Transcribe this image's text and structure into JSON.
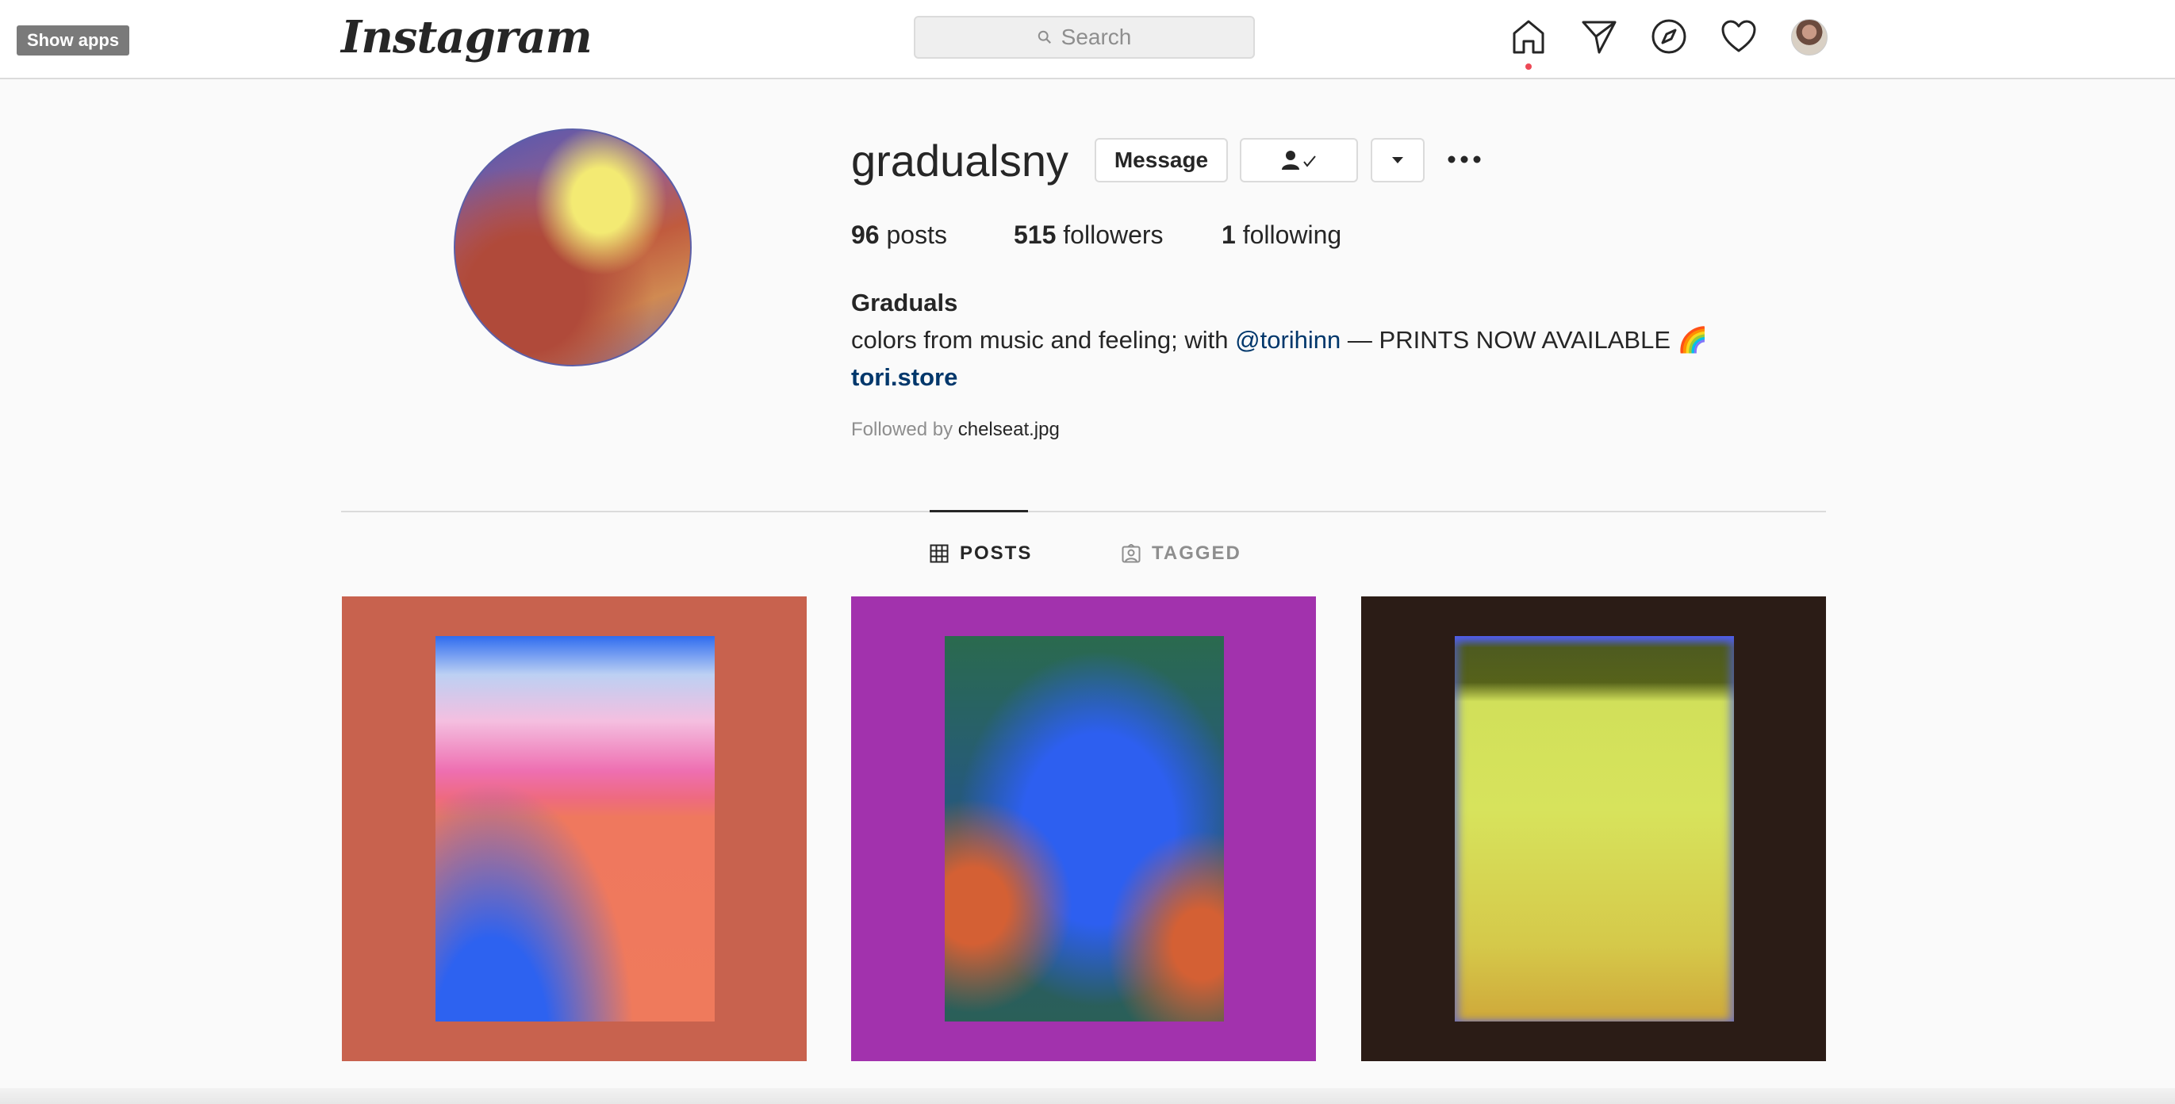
{
  "overlay": {
    "show_apps_label": "Show apps"
  },
  "header": {
    "logo_text": "Instagram",
    "search_placeholder": "Search",
    "icons": [
      "home-icon",
      "direct-icon",
      "explore-icon",
      "activity-heart-icon",
      "profile-avatar"
    ]
  },
  "profile": {
    "username": "gradualsny",
    "message_button": "Message",
    "stats": {
      "posts_count": "96",
      "posts_label": "posts",
      "followers_count": "515",
      "followers_label": "followers",
      "following_count": "1",
      "following_label": "following"
    },
    "full_name": "Graduals",
    "bio_prefix": "colors from music and feeling; with ",
    "bio_mention": "@torihinn",
    "bio_suffix": " — PRINTS NOW AVAILABLE 🌈",
    "link": "tori.store",
    "followed_by_prefix": "Followed by ",
    "followed_by_name": "chelseat.jpg"
  },
  "tabs": {
    "posts": "POSTS",
    "tagged": "TAGGED"
  },
  "colors": {
    "post1_bg": "#c8624e",
    "post2_bg": "#a232ad",
    "post3_bg": "#2b1c16",
    "link": "#00376b"
  }
}
